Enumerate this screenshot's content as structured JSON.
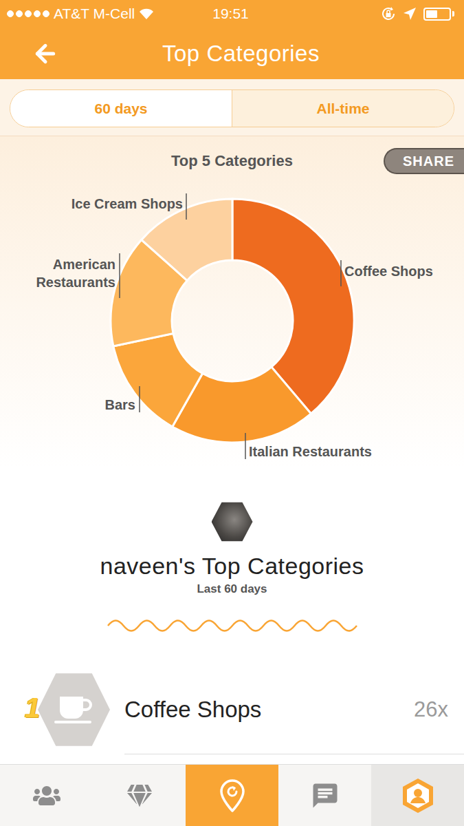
{
  "status_bar": {
    "carrier": "AT&T M-Cell",
    "signal": {
      "level": 1
    },
    "wifi": true,
    "time": "19:51",
    "battery": {
      "level": 0.5
    }
  },
  "nav_bar": {
    "title": "Top Categories"
  },
  "range_tabs": [
    {
      "label": "60 days",
      "selected": true
    },
    {
      "label": "All-time",
      "selected": false
    }
  ],
  "chart": {
    "title": "Top 5 Categories",
    "share_button": "SHARE",
    "slices": [
      {
        "label": "Coffee Shops",
        "value": 26,
        "color": "#ee6b1f"
      },
      {
        "label": "Italian Restaurants",
        "value": 13,
        "color": "#f9992c"
      },
      {
        "label": "Bars",
        "value": 9,
        "color": "#fba63b"
      },
      {
        "label": "American Restaurants",
        "value": 10,
        "color": "#fdb85d"
      },
      {
        "label": "Ice Cream Shops",
        "value": 9,
        "color": "#fdd19f"
      }
    ]
  },
  "profile": {
    "heading": "naveen's Top Categories",
    "subtitle": "Last 60 days"
  },
  "ranking": [
    {
      "rank": "1",
      "category": "Coffee Shops",
      "count": "26x"
    }
  ],
  "tab_bar": [
    {
      "kind": "tab",
      "selected": false
    },
    {
      "kind": "tab",
      "selected": false
    },
    {
      "kind": "primary",
      "selected": false
    },
    {
      "kind": "tab",
      "selected": false
    },
    {
      "kind": "tab",
      "selected": true
    }
  ]
}
